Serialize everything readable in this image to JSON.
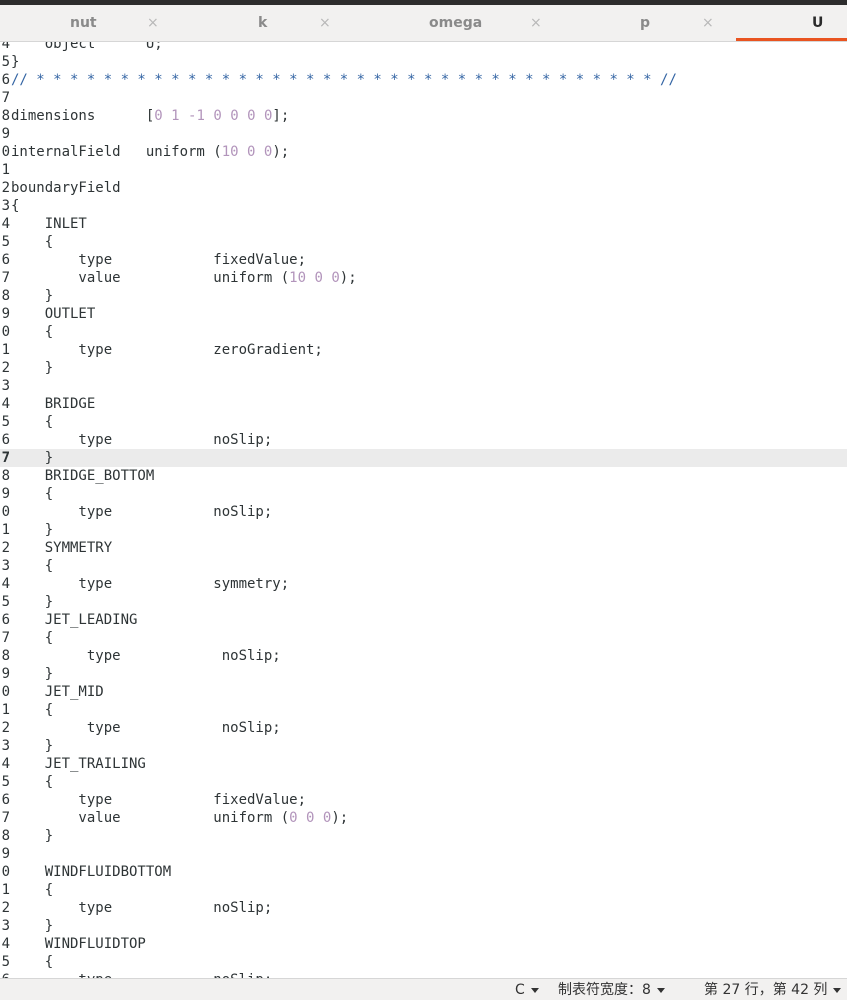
{
  "tabs": [
    {
      "label": "nut",
      "active": false
    },
    {
      "label": "k",
      "active": false
    },
    {
      "label": "omega",
      "active": false
    },
    {
      "label": "p",
      "active": false
    },
    {
      "label": "U",
      "active": true
    }
  ],
  "close_glyph": "×",
  "editor": {
    "current_line": 27,
    "lines": [
      {
        "n": "4",
        "t": "    object      U;"
      },
      {
        "n": "5",
        "t": "}"
      },
      {
        "n": "6",
        "t": "// * * * * * * * * * * * * * * * * * * * * * * * * * * * * * * * * * * * * * //"
      },
      {
        "n": "7",
        "t": ""
      },
      {
        "n": "8",
        "t": "dimensions      [0 1 -1 0 0 0 0];"
      },
      {
        "n": "9",
        "t": ""
      },
      {
        "n": "0",
        "t": "internalField   uniform (10 0 0);"
      },
      {
        "n": "1",
        "t": ""
      },
      {
        "n": "2",
        "t": "boundaryField"
      },
      {
        "n": "3",
        "t": "{"
      },
      {
        "n": "4",
        "t": "    INLET"
      },
      {
        "n": "5",
        "t": "    {"
      },
      {
        "n": "6",
        "t": "        type            fixedValue;"
      },
      {
        "n": "7",
        "t": "        value           uniform (10 0 0);"
      },
      {
        "n": "8",
        "t": "    }"
      },
      {
        "n": "9",
        "t": "    OUTLET"
      },
      {
        "n": "0",
        "t": "    {"
      },
      {
        "n": "1",
        "t": "        type            zeroGradient;"
      },
      {
        "n": "2",
        "t": "    }"
      },
      {
        "n": "3",
        "t": ""
      },
      {
        "n": "4",
        "t": "    BRIDGE"
      },
      {
        "n": "5",
        "t": "    {"
      },
      {
        "n": "6",
        "t": "        type            noSlip;"
      },
      {
        "n": "7",
        "t": "    }"
      },
      {
        "n": "8",
        "t": "    BRIDGE_BOTTOM"
      },
      {
        "n": "9",
        "t": "    {"
      },
      {
        "n": "0",
        "t": "        type            noSlip;"
      },
      {
        "n": "1",
        "t": "    }"
      },
      {
        "n": "2",
        "t": "    SYMMETRY"
      },
      {
        "n": "3",
        "t": "    {"
      },
      {
        "n": "4",
        "t": "        type            symmetry;"
      },
      {
        "n": "5",
        "t": "    }"
      },
      {
        "n": "6",
        "t": "    JET_LEADING"
      },
      {
        "n": "7",
        "t": "    {"
      },
      {
        "n": "8",
        "t": "         type            noSlip;"
      },
      {
        "n": "9",
        "t": "    }"
      },
      {
        "n": "0",
        "t": "    JET_MID"
      },
      {
        "n": "1",
        "t": "    {"
      },
      {
        "n": "2",
        "t": "         type            noSlip;"
      },
      {
        "n": "3",
        "t": "    }"
      },
      {
        "n": "4",
        "t": "    JET_TRAILING"
      },
      {
        "n": "5",
        "t": "    {"
      },
      {
        "n": "6",
        "t": "        type            fixedValue;"
      },
      {
        "n": "7",
        "t": "        value           uniform (0 0 0);"
      },
      {
        "n": "8",
        "t": "    }"
      },
      {
        "n": "9",
        "t": ""
      },
      {
        "n": "0",
        "t": "    WINDFLUIDBOTTOM"
      },
      {
        "n": "1",
        "t": "    {"
      },
      {
        "n": "2",
        "t": "        type            noSlip;"
      },
      {
        "n": "3",
        "t": "    }"
      },
      {
        "n": "4",
        "t": "    WINDFLUIDTOP"
      },
      {
        "n": "5",
        "t": "    {"
      },
      {
        "n": "6",
        "t": "        type            noSlip;"
      }
    ]
  },
  "status": {
    "language": "C",
    "tab_width": "制表符宽度：8",
    "position": "第 27 行，第 42 列"
  }
}
